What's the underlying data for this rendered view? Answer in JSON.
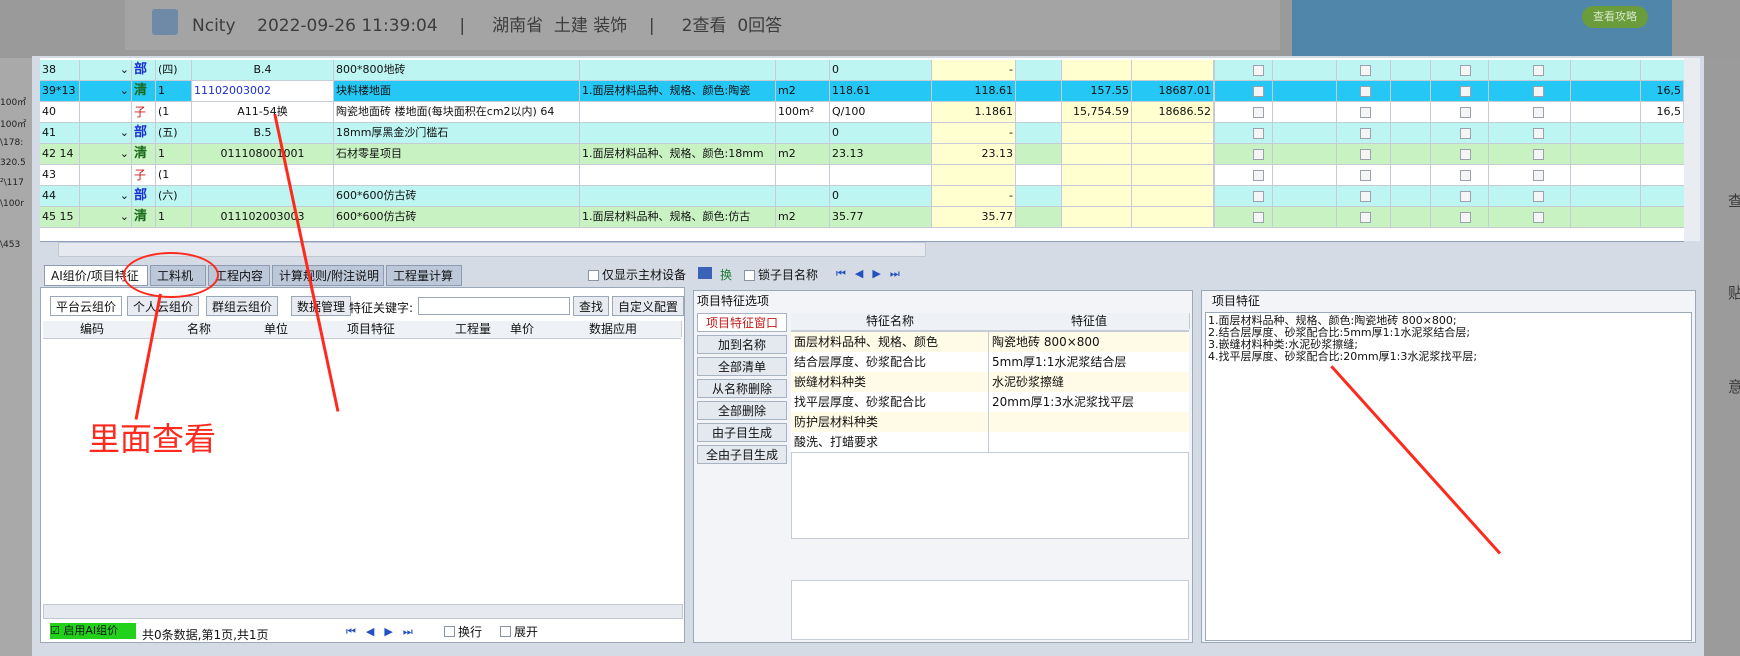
{
  "forum": {
    "author": "Ncity",
    "datetime": "2022-09-26 11:39:04",
    "region": "湖南省",
    "category": "土建 装饰",
    "views": "2查看",
    "replies": "0回答",
    "ad_button": "查看攻略"
  },
  "right_side": [
    "查",
    "贴",
    "意"
  ],
  "left_peek": [
    "100㎡",
    "100㎡",
    "\\178:",
    "320.5",
    "²\\117",
    "\\100r",
    "\\453"
  ],
  "grid_rows": [
    {
      "idx": "38",
      "code": "",
      "type": "部",
      "name_short": "(四)",
      "item_code": "B.4",
      "name": "800*800地砖",
      "feature": "",
      "unit": "",
      "qty": "0",
      "qty2": "-",
      "price": "",
      "total": "",
      "kind": "section"
    },
    {
      "idx": "39*13",
      "code": "",
      "type": "清",
      "name_short": "1",
      "item_code": "11102003002",
      "name": "块料楼地面",
      "feature": "1.面层材料品种、规格、颜色:陶瓷",
      "unit": "m2",
      "qty": "118.61",
      "qty2": "118.61",
      "price": "157.55",
      "total": "18687.01",
      "kind": "selected"
    },
    {
      "idx": "40",
      "code": "",
      "type": "子",
      "name_short": "(1",
      "item_code": "A11-54换",
      "name": "陶瓷地面砖 楼地面(每块面积在cm2以内) 64",
      "feature": "",
      "unit": "100m²",
      "qty": "Q/100",
      "qty2": "1.1861",
      "price": "15,754.59",
      "total": "18686.52",
      "kind": "child"
    },
    {
      "idx": "41",
      "code": "",
      "type": "部",
      "name_short": "(五)",
      "item_code": "B.5",
      "name": "18mm厚黑金沙门槛石",
      "feature": "",
      "unit": "",
      "qty": "0",
      "qty2": "-",
      "price": "",
      "total": "",
      "kind": "section"
    },
    {
      "idx": "42 14",
      "code": "",
      "type": "清",
      "name_short": "1",
      "item_code": "011108001001",
      "name": "石材零星项目",
      "feature": "1.面层材料品种、规格、颜色:18mm",
      "unit": "m2",
      "qty": "23.13",
      "qty2": "23.13",
      "price": "",
      "total": "",
      "kind": "list"
    },
    {
      "idx": "43",
      "code": "",
      "type": "子",
      "name_short": "(1",
      "item_code": "",
      "name": "",
      "feature": "",
      "unit": "",
      "qty": "",
      "qty2": "",
      "price": "",
      "total": "",
      "kind": "child"
    },
    {
      "idx": "44",
      "code": "",
      "type": "部",
      "name_short": "(六)",
      "item_code": "",
      "name": "600*600仿古砖",
      "feature": "",
      "unit": "",
      "qty": "0",
      "qty2": "-",
      "price": "",
      "total": "",
      "kind": "section"
    },
    {
      "idx": "45 15",
      "code": "",
      "type": "清",
      "name_short": "1",
      "item_code": "011102003003",
      "name": "600*600仿古砖",
      "feature": "1.面层材料品种、规格、颜色:仿古",
      "unit": "m2",
      "qty": "35.77",
      "qty2": "35.77",
      "price": "",
      "total": "",
      "kind": "list"
    }
  ],
  "row_extra": {
    "far_right_1": "16,5",
    "far_right_2": "16,5"
  },
  "tabs": [
    "AI组价/项目特征",
    "工料机",
    "工程内容",
    "计算规则/附注说明",
    "工程量计算"
  ],
  "toolbar": {
    "show_main": "仅显示主材设备",
    "swap": "换",
    "lock_name": "锁子目名称"
  },
  "subtabs": [
    "平台云组价",
    "个人云组价",
    "群组云组价"
  ],
  "left_toolbar": {
    "data_mgmt": "数据管理",
    "keyword_label": "特征关键字:",
    "search": "查找",
    "custom": "自定义配置"
  },
  "left_headers": [
    "编码",
    "名称",
    "单位",
    "项目特征",
    "工程量",
    "单价",
    "数据应用"
  ],
  "left_status": {
    "ai_toggle": "启用AI组价",
    "page_info": "共0条数据,第1页,共1页",
    "wrap": "换行",
    "expand": "展开"
  },
  "feature_options": {
    "title": "项目特征选项",
    "buttons": [
      "项目特征窗口",
      "加到名称",
      "全部清单",
      "从名称删除",
      "全部删除",
      "由子目生成",
      "全由子目生成"
    ],
    "headers": [
      "特征名称",
      "特征值"
    ],
    "rows": [
      {
        "name": "面层材料品种、规格、颜色",
        "value": "陶瓷地砖 800×800"
      },
      {
        "name": "结合层厚度、砂浆配合比",
        "value": "5mm厚1:1水泥浆结合层"
      },
      {
        "name": "嵌缝材料种类",
        "value": "水泥砂浆擦缝"
      },
      {
        "name": "找平层厚度、砂浆配合比",
        "value": "20mm厚1:3水泥浆找平层"
      },
      {
        "name": "防护层材料种类",
        "value": ""
      },
      {
        "name": "酸洗、打蜡要求",
        "value": ""
      }
    ]
  },
  "project_feature": {
    "title": "项目特征",
    "lines": [
      "1.面层材料品种、规格、颜色:陶瓷地砖 800×800;",
      "2.结合层厚度、砂浆配合比:5mm厚1:1水泥浆结合层;",
      "3.嵌缝材料种类:水泥砂浆擦缝;",
      "4.找平层厚度、砂浆配合比:20mm厚1:3水泥浆找平层;"
    ]
  },
  "annotation": {
    "text": "里面查看",
    "color": "#ff2a1e"
  }
}
